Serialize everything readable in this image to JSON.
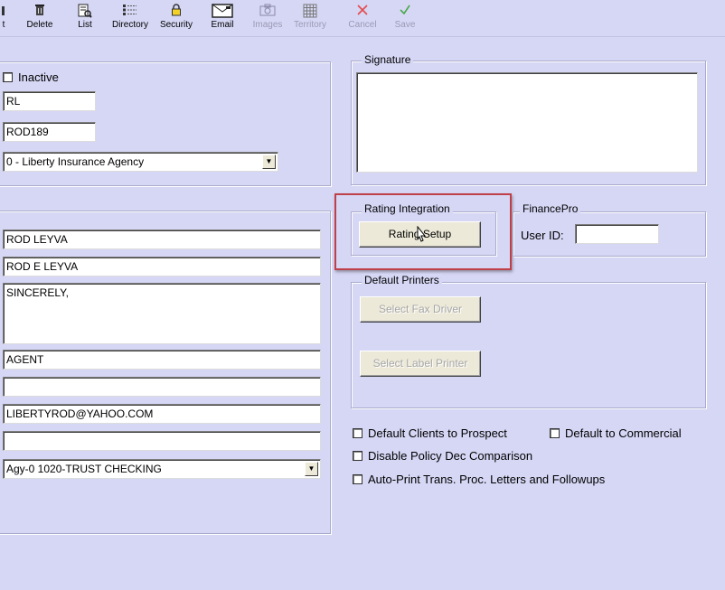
{
  "toolbar": {
    "items": [
      {
        "label": "Delete",
        "icon": "trash-icon",
        "enabled": true
      },
      {
        "label": "List",
        "icon": "list-search-icon",
        "enabled": true
      },
      {
        "label": "Directory",
        "icon": "directory-icon",
        "enabled": true
      },
      {
        "label": "Security",
        "icon": "lock-icon",
        "enabled": true
      },
      {
        "label": "Email",
        "icon": "email-icon",
        "enabled": true
      },
      {
        "label": "Images",
        "icon": "camera-icon",
        "enabled": false
      },
      {
        "label": "Territory",
        "icon": "grid-icon",
        "enabled": false
      },
      {
        "label": "Cancel",
        "icon": "cancel-x-icon",
        "enabled": false
      },
      {
        "label": "Save",
        "icon": "checkmark-icon",
        "enabled": false
      }
    ],
    "cut_label_prefix": "t",
    "cancel_color": "#e34b4b",
    "save_color": "#4aa84a"
  },
  "left_top": {
    "inactive_label": "Inactive",
    "code_value": "RL",
    "id_value": "ROD189",
    "agency_value": "0 - Liberty Insurance Agency"
  },
  "left_main": {
    "name_value": "ROD LEYVA",
    "full_name_value": "ROD E LEYVA",
    "closing_value": "SINCERELY,",
    "title_value": "AGENT",
    "blank1_value": "",
    "email_value": "LIBERTYROD@YAHOO.COM",
    "blank2_value": "",
    "account_value": "Agy-0  1020-TRUST CHECKING"
  },
  "signature": {
    "legend": "Signature"
  },
  "rating": {
    "legend": "Rating Integration",
    "button_label": "Rating Setup"
  },
  "financepro": {
    "legend": "FinancePro",
    "user_id_label": "User ID:",
    "user_id_value": ""
  },
  "printers": {
    "legend": "Default Printers",
    "fax_button": "Select Fax Driver",
    "label_button": "Select Label Printer"
  },
  "options": {
    "default_clients_prospect": "Default Clients to Prospect",
    "default_commercial": "Default to Commercial",
    "disable_policy_dec": "Disable Policy Dec Comparison",
    "auto_print": "Auto-Print Trans. Proc. Letters and Followups"
  },
  "colors": {
    "background": "#d6d7f5",
    "highlight_border": "#c0404a"
  }
}
